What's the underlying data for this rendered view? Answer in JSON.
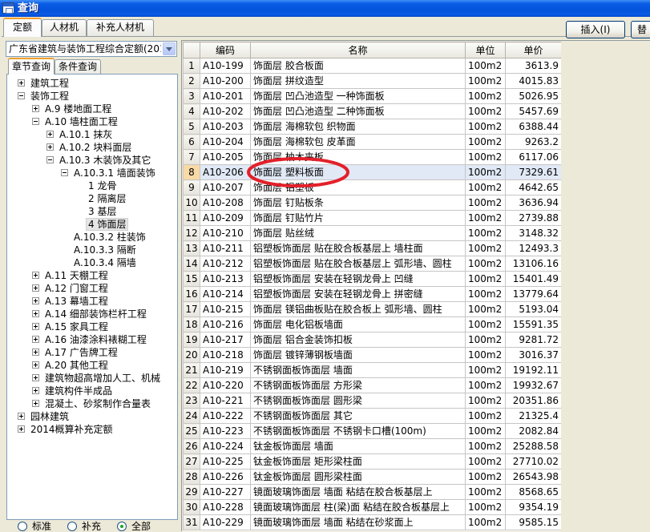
{
  "window": {
    "title": "查询"
  },
  "main_tabs": [
    {
      "label": "定额",
      "active": true
    },
    {
      "label": "人材机",
      "active": false
    },
    {
      "label": "补充人材机",
      "active": false
    }
  ],
  "toolbar": {
    "insert_label": "插入(I)",
    "replace_label": "替"
  },
  "quota_select": {
    "value": "广东省建筑与装饰工程综合定额(201"
  },
  "left_tabs": [
    {
      "label": "章节查询",
      "active": true
    },
    {
      "label": "条件查询",
      "active": false
    }
  ],
  "tree": [
    {
      "label": "建筑工程",
      "expander_icon": "plus-box-icon"
    },
    {
      "label": "装饰工程",
      "expander_icon": "minus-box-icon",
      "children": [
        {
          "label": "A.9 楼地面工程",
          "expander_icon": "plus-box-icon"
        },
        {
          "label": "A.10 墙柱面工程",
          "expander_icon": "minus-box-icon",
          "children": [
            {
              "label": "A.10.1 抹灰",
              "expander_icon": "plus-box-icon"
            },
            {
              "label": "A.10.2 块料面层",
              "expander_icon": "plus-box-icon"
            },
            {
              "label": "A.10.3 木装饰及其它",
              "expander_icon": "minus-box-icon",
              "children": [
                {
                  "label": "A.10.3.1 墙面装饰",
                  "expander_icon": "minus-box-icon",
                  "children": [
                    {
                      "label": "1 龙骨"
                    },
                    {
                      "label": "2 隔离层"
                    },
                    {
                      "label": "3 基层"
                    },
                    {
                      "label": "4 饰面层",
                      "selected": true
                    }
                  ]
                },
                {
                  "label": "A.10.3.2 柱装饰"
                },
                {
                  "label": "A.10.3.3 隔断"
                },
                {
                  "label": "A.10.3.4 隔墙"
                }
              ]
            }
          ]
        },
        {
          "label": "A.11 天棚工程",
          "expander_icon": "plus-box-icon"
        },
        {
          "label": "A.12 门窗工程",
          "expander_icon": "plus-box-icon"
        },
        {
          "label": "A.13 幕墙工程",
          "expander_icon": "plus-box-icon"
        },
        {
          "label": "A.14 细部装饰栏杆工程",
          "expander_icon": "plus-box-icon"
        },
        {
          "label": "A.15 家具工程",
          "expander_icon": "plus-box-icon"
        },
        {
          "label": "A.16 油漆涂料裱糊工程",
          "expander_icon": "plus-box-icon"
        },
        {
          "label": "A.17 广告牌工程",
          "expander_icon": "plus-box-icon"
        },
        {
          "label": "A.20 其他工程",
          "expander_icon": "plus-box-icon"
        },
        {
          "label": "建筑物超高增加人工、机械",
          "expander_icon": "plus-box-icon"
        },
        {
          "label": "建筑构件半成品",
          "expander_icon": "plus-box-icon"
        },
        {
          "label": "混凝土、砂浆制作合量表",
          "expander_icon": "plus-box-icon"
        }
      ]
    },
    {
      "label": "园林建筑",
      "expander_icon": "plus-box-icon"
    },
    {
      "label": "2014概算补充定额",
      "expander_icon": "plus-box-icon"
    }
  ],
  "scope_options": [
    {
      "label": "标准",
      "checked": false
    },
    {
      "label": "补充",
      "checked": false
    },
    {
      "label": "全部",
      "checked": true
    }
  ],
  "table": {
    "headers": {
      "code": "编码",
      "name": "名称",
      "unit": "单位",
      "price": "单价"
    },
    "rows": [
      {
        "no": "1",
        "code": "A10-199",
        "name": "饰面层 胶合板面",
        "unit": "100m2",
        "price": "3613.9"
      },
      {
        "no": "2",
        "code": "A10-200",
        "name": "饰面层 拼纹造型",
        "unit": "100m2",
        "price": "4015.83"
      },
      {
        "no": "3",
        "code": "A10-201",
        "name": "饰面层 凹凸池造型 一种饰面板",
        "unit": "100m2",
        "price": "5026.95"
      },
      {
        "no": "4",
        "code": "A10-202",
        "name": "饰面层 凹凸池造型 二种饰面板",
        "unit": "100m2",
        "price": "5457.69"
      },
      {
        "no": "5",
        "code": "A10-203",
        "name": "饰面层 海棉软包 织物面",
        "unit": "100m2",
        "price": "6388.44"
      },
      {
        "no": "6",
        "code": "A10-204",
        "name": "饰面层 海棉软包 皮革面",
        "unit": "100m2",
        "price": "9263.2"
      },
      {
        "no": "7",
        "code": "A10-205",
        "name": "饰面层 柚木夹板",
        "unit": "100m2",
        "price": "6117.06"
      },
      {
        "no": "8",
        "code": "A10-206",
        "name": "饰面层 塑料板面",
        "unit": "100m2",
        "price": "7329.61",
        "selected": true
      },
      {
        "no": "9",
        "code": "A10-207",
        "name": "饰面层 铝塑板",
        "unit": "100m2",
        "price": "4642.65"
      },
      {
        "no": "10",
        "code": "A10-208",
        "name": "饰面层 钉贴板条",
        "unit": "100m2",
        "price": "3636.94"
      },
      {
        "no": "11",
        "code": "A10-209",
        "name": "饰面层 钉贴竹片",
        "unit": "100m2",
        "price": "2739.88"
      },
      {
        "no": "12",
        "code": "A10-210",
        "name": "饰面层 贴丝绒",
        "unit": "100m2",
        "price": "3148.32"
      },
      {
        "no": "13",
        "code": "A10-211",
        "name": "铝塑板饰面层 贴在胶合板基层上 墙柱面",
        "unit": "100m2",
        "price": "12493.3"
      },
      {
        "no": "14",
        "code": "A10-212",
        "name": "铝塑板饰面层 贴在胶合板基层上 弧形墙、圆柱",
        "unit": "100m2",
        "price": "13106.16"
      },
      {
        "no": "15",
        "code": "A10-213",
        "name": "铝塑板饰面层 安装在轻钢龙骨上 凹缝",
        "unit": "100m2",
        "price": "15401.49"
      },
      {
        "no": "16",
        "code": "A10-214",
        "name": "铝塑板饰面层 安装在轻钢龙骨上 拼密缝",
        "unit": "100m2",
        "price": "13779.64"
      },
      {
        "no": "17",
        "code": "A10-215",
        "name": "饰面层 镁铝曲板贴在胶合板上 弧形墙、圆柱",
        "unit": "100m2",
        "price": "5193.04"
      },
      {
        "no": "18",
        "code": "A10-216",
        "name": "饰面层 电化铝板墙面",
        "unit": "100m2",
        "price": "15591.35"
      },
      {
        "no": "19",
        "code": "A10-217",
        "name": "饰面层 铝合金装饰扣板",
        "unit": "100m2",
        "price": "9281.72"
      },
      {
        "no": "20",
        "code": "A10-218",
        "name": "饰面层 镀锌薄钢板墙面",
        "unit": "100m2",
        "price": "3016.37"
      },
      {
        "no": "21",
        "code": "A10-219",
        "name": "不锈钢面板饰面层 墙面",
        "unit": "100m2",
        "price": "19192.11"
      },
      {
        "no": "22",
        "code": "A10-220",
        "name": "不锈钢面板饰面层 方形梁",
        "unit": "100m2",
        "price": "19932.67"
      },
      {
        "no": "23",
        "code": "A10-221",
        "name": "不锈钢面板饰面层 圆形梁",
        "unit": "100m2",
        "price": "20351.86"
      },
      {
        "no": "24",
        "code": "A10-222",
        "name": "不锈钢面板饰面层 其它",
        "unit": "100m2",
        "price": "21325.4"
      },
      {
        "no": "25",
        "code": "A10-223",
        "name": "不锈钢面板饰面层 不锈钢卡口槽(100m)",
        "unit": "100m2",
        "price": "2082.84"
      },
      {
        "no": "26",
        "code": "A10-224",
        "name": "钛金板饰面层 墙面",
        "unit": "100m2",
        "price": "25288.58"
      },
      {
        "no": "27",
        "code": "A10-225",
        "name": "钛金板饰面层 矩形梁柱面",
        "unit": "100m2",
        "price": "27710.02"
      },
      {
        "no": "28",
        "code": "A10-226",
        "name": "钛金板饰面层 圆形梁柱面",
        "unit": "100m2",
        "price": "26543.98"
      },
      {
        "no": "29",
        "code": "A10-227",
        "name": "镜面玻璃饰面层 墙面 粘结在胶合板基层上",
        "unit": "100m2",
        "price": "8568.65"
      },
      {
        "no": "30",
        "code": "A10-228",
        "name": "镜面玻璃饰面层 柱(梁)面 粘结在胶合板基层上",
        "unit": "100m2",
        "price": "9354.19"
      },
      {
        "no": "31",
        "code": "A10-229",
        "name": "镜面玻璃饰面层 墙面 粘结在砂浆面上",
        "unit": "100m2",
        "price": "9585.15"
      }
    ]
  },
  "colors": {
    "title_bar": "#0a5ce6",
    "selected_row": "#e1e9f6",
    "selected_row_number": "#f9d9a6",
    "annotation": "#e3202a"
  }
}
